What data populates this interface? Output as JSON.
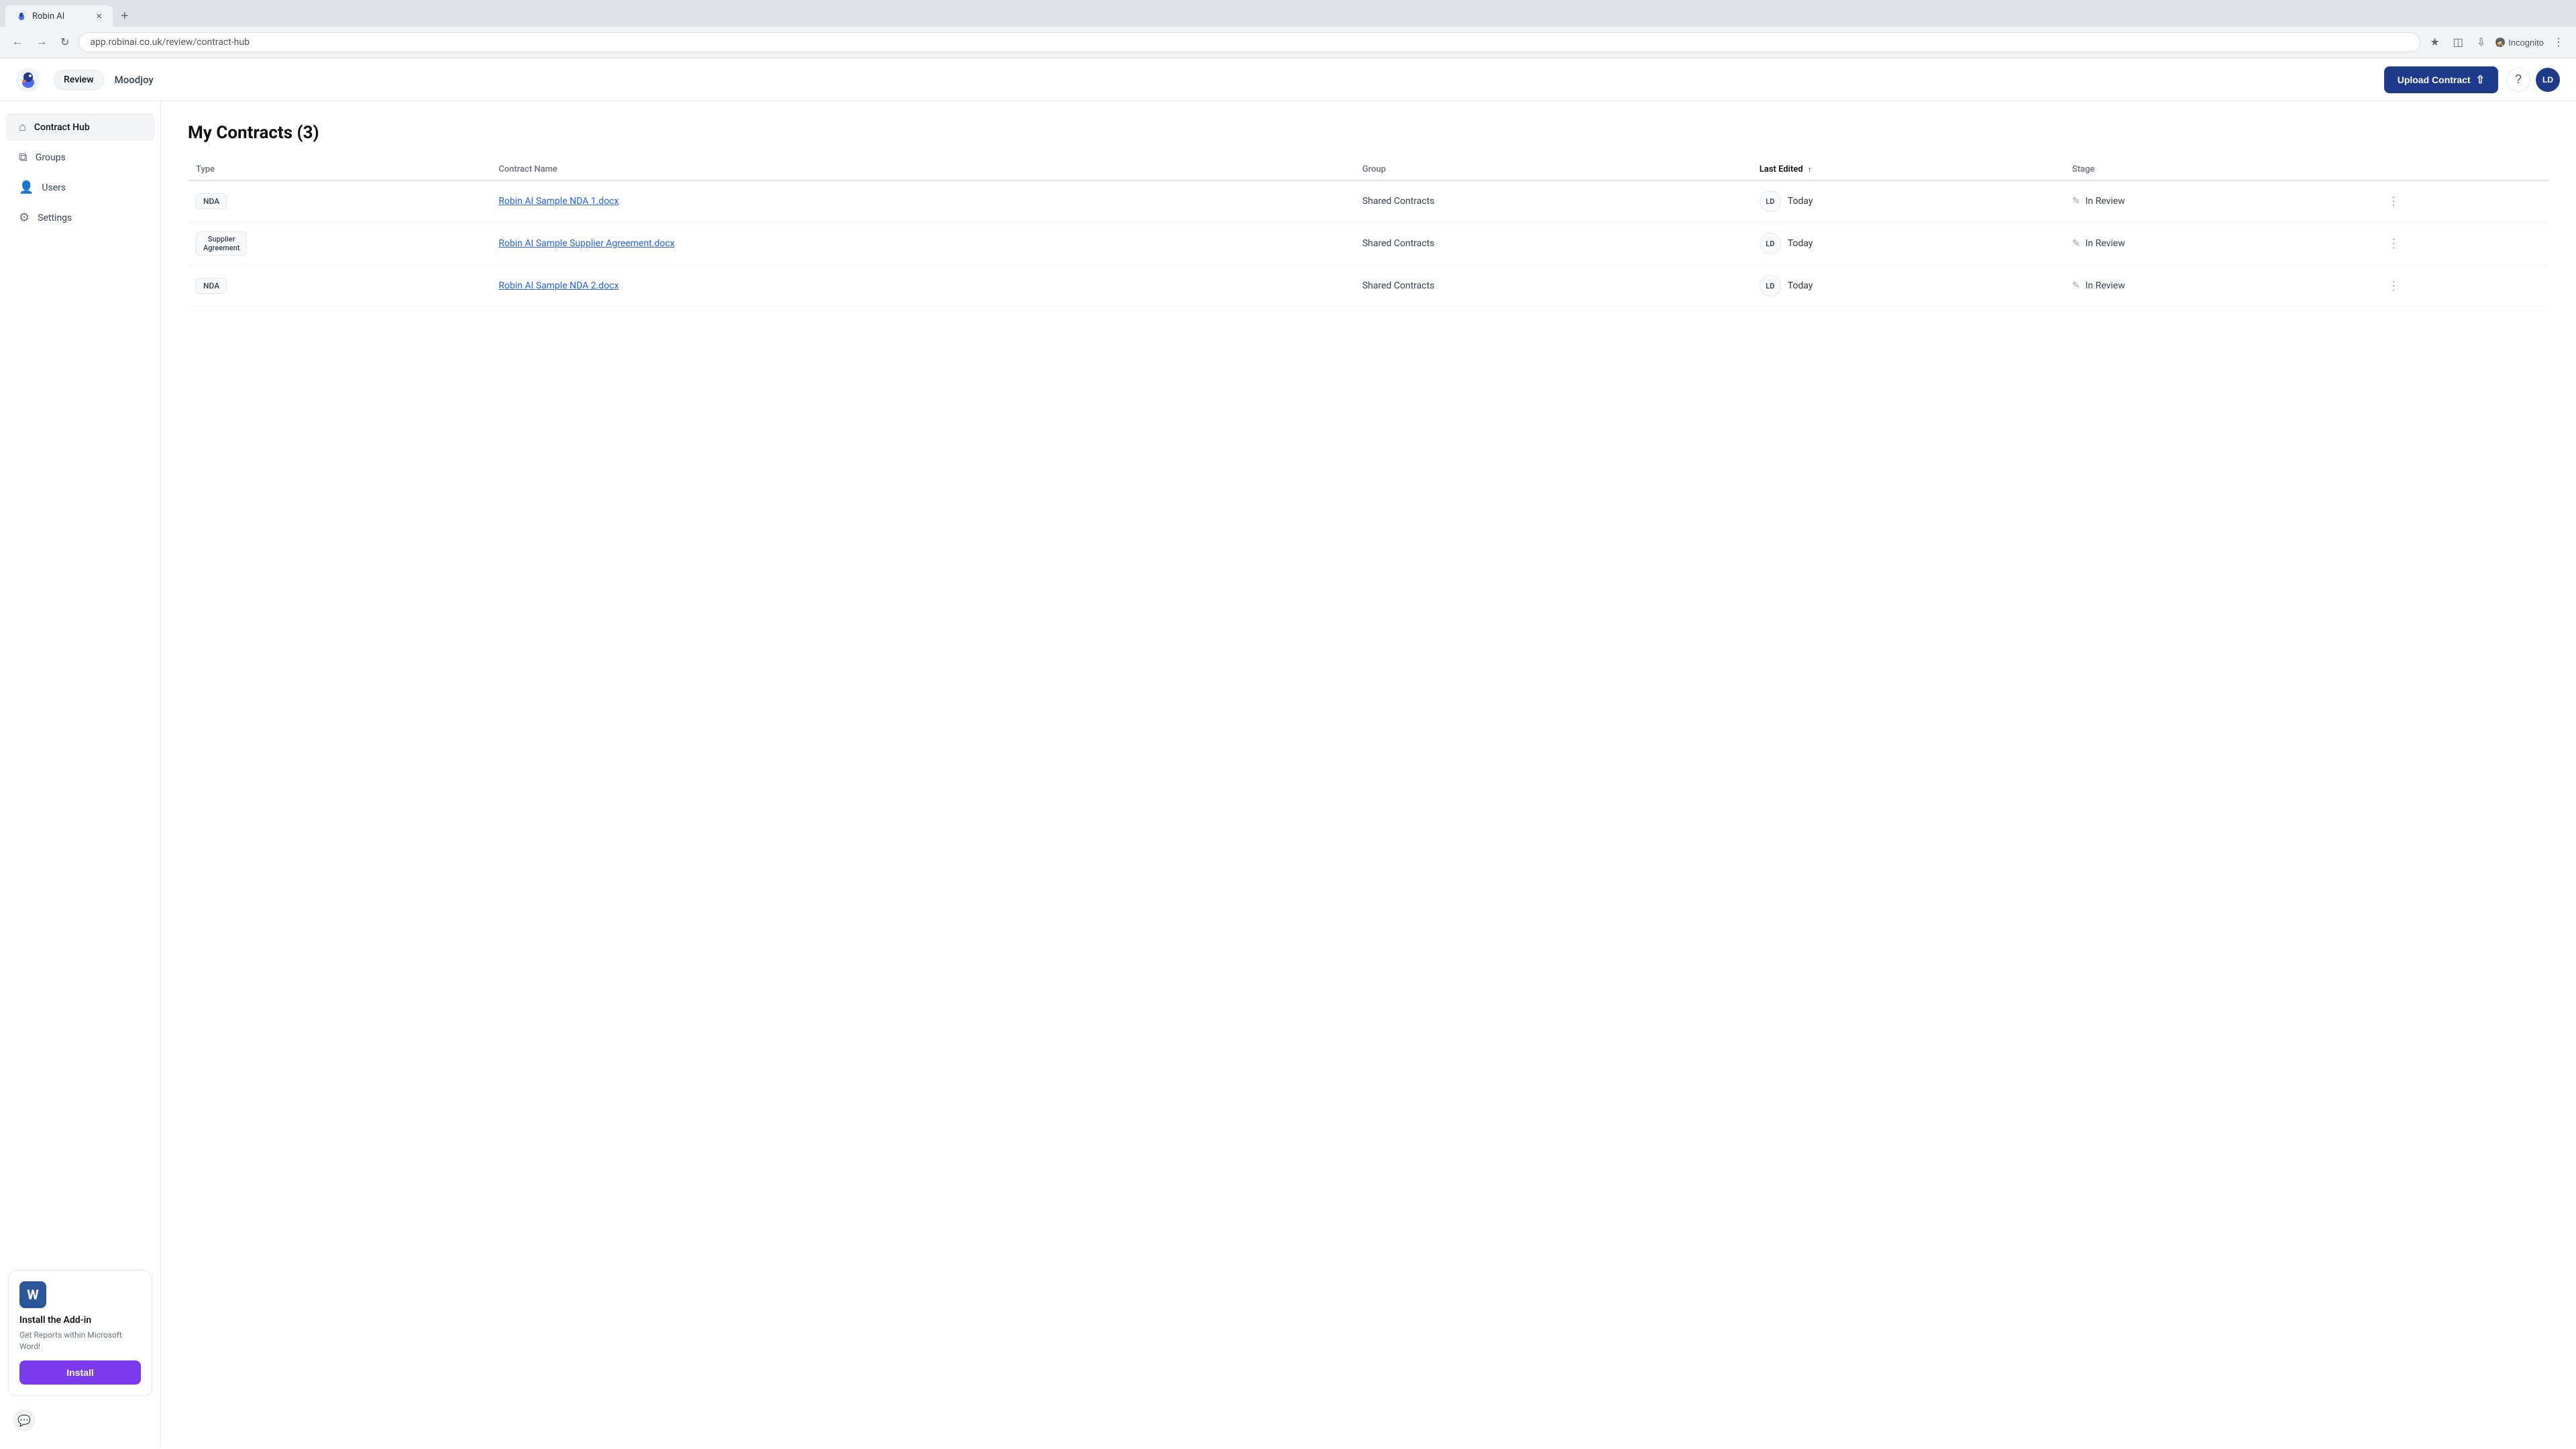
{
  "browser": {
    "tab_label": "Robin AI",
    "tab_close": "×",
    "new_tab": "+",
    "address": "app.robinai.co.uk/review/contract-hub",
    "incognito_label": "Incognito"
  },
  "header": {
    "nav_review": "Review",
    "workspace": "Moodjoy",
    "upload_btn": "Upload Contract",
    "avatar_initials": "LD"
  },
  "sidebar": {
    "items": [
      {
        "label": "Contract Hub",
        "active": true
      },
      {
        "label": "Groups",
        "active": false
      },
      {
        "label": "Users",
        "active": false
      },
      {
        "label": "Settings",
        "active": false
      }
    ],
    "addon": {
      "word_letter": "W",
      "title": "Install the Add-in",
      "desc": "Get Reports within Microsoft Word!",
      "install_btn": "Install"
    }
  },
  "main": {
    "page_title": "My Contracts (3)",
    "table": {
      "columns": [
        "Type",
        "Contract Name",
        "Group",
        "Last Edited",
        "Stage"
      ],
      "rows": [
        {
          "type": "NDA",
          "name": "Robin AI Sample NDA 1.docx",
          "group": "Shared Contracts",
          "avatar": "LD",
          "last_edited": "Today",
          "stage": "In Review"
        },
        {
          "type": "Supplier Agreement",
          "name": "Robin AI Sample Supplier Agreement.docx",
          "group": "Shared Contracts",
          "avatar": "LD",
          "last_edited": "Today",
          "stage": "In Review"
        },
        {
          "type": "NDA",
          "name": "Robin AI Sample NDA 2.docx",
          "group": "Shared Contracts",
          "avatar": "LD",
          "last_edited": "Today",
          "stage": "In Review"
        }
      ]
    }
  }
}
